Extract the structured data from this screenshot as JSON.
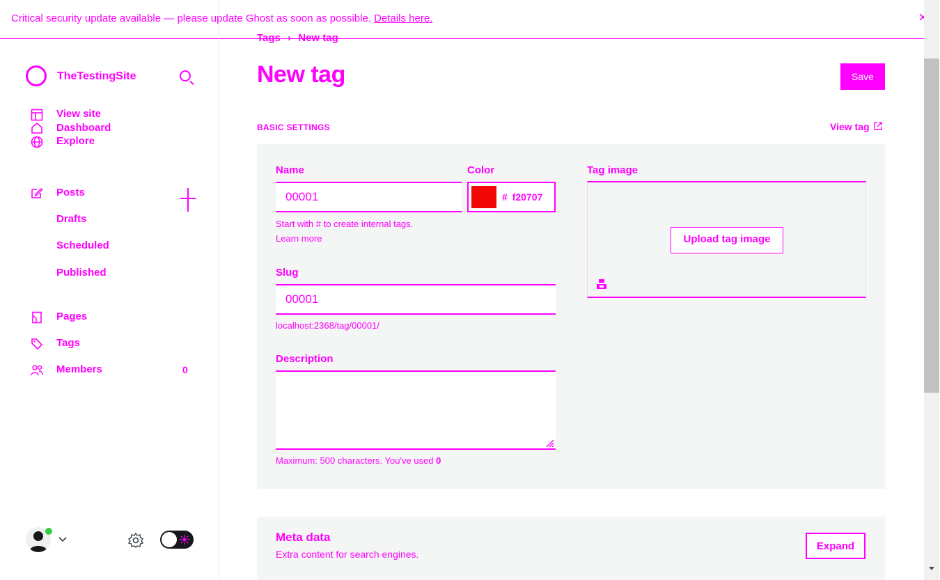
{
  "banner": {
    "message": "Critical security update available — please update Ghost as soon as possible.",
    "link": "Details here.",
    "close_icon": "×"
  },
  "sidebar": {
    "site_name": "TheTestingSite",
    "nav": [
      {
        "label": "Dashboard",
        "icon": "home-icon"
      },
      {
        "label": "View site",
        "icon": "layout-icon"
      },
      {
        "label": "Explore",
        "icon": "globe-icon"
      }
    ],
    "posts": {
      "label": "Posts",
      "subitems": [
        "Drafts",
        "Scheduled",
        "Published"
      ]
    },
    "pages_label": "Pages",
    "tags_label": "Tags",
    "members_label": "Members",
    "members_count": "0"
  },
  "breadcrumb": {
    "parent": "Tags",
    "separator": "›",
    "current": "New tag"
  },
  "page": {
    "title": "New tag",
    "save_label": "Save",
    "basic_settings_label": "BASIC SETTINGS",
    "view_tag_label": "View tag"
  },
  "form": {
    "name_label": "Name",
    "name_value": "00001",
    "name_hint": "Start with # to create internal tags.",
    "learn_more": "Learn more",
    "color_label": "Color",
    "color_hash": "#",
    "color_value": "f20707",
    "color_hex": "#f20707",
    "slug_label": "Slug",
    "slug_value": "00001",
    "slug_url": "localhost:2368/tag/00001/",
    "description_label": "Description",
    "description_value": "",
    "description_hint": "Maximum: 500 characters. You've used",
    "description_count": "0",
    "image_label": "Tag image",
    "upload_label": "Upload tag image"
  },
  "meta": {
    "title": "Meta data",
    "description": "Extra content for search engines.",
    "expand_label": "Expand"
  },
  "colors": {
    "accent": "#ff00ff",
    "swatch": "#f20707",
    "online": "#30cf43",
    "panel": "#f4f5f5"
  }
}
